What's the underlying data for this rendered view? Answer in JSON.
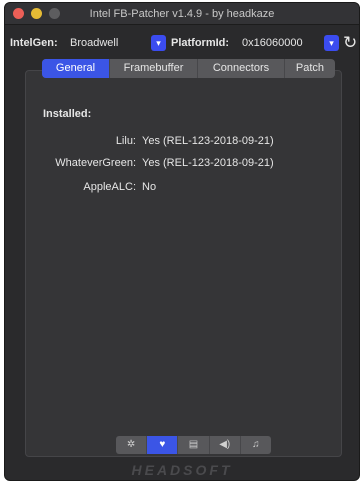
{
  "window": {
    "title": "Intel FB-Patcher v1.4.9 - by headkaze"
  },
  "toolbar": {
    "intelgen_label": "IntelGen:",
    "intelgen_value": "Broadwell",
    "platformid_label": "PlatformId:",
    "platformid_value": "0x16060000",
    "refresh_icon": "refresh-icon"
  },
  "tabs": [
    {
      "label": "General",
      "active": true
    },
    {
      "label": "Framebuffer",
      "active": false
    },
    {
      "label": "Connectors",
      "active": false
    },
    {
      "label": "Patch",
      "active": false
    }
  ],
  "general": {
    "installed_heading": "Installed:",
    "rows": [
      {
        "key": "Lilu:",
        "value": "Yes (REL-123-2018-09-21)"
      },
      {
        "key": "WhateverGreen:",
        "value": "Yes (REL-123-2018-09-21)"
      },
      {
        "key": "AppleALC:",
        "value": "No"
      }
    ]
  },
  "bottom_segments": [
    {
      "icon": "gear-icon",
      "glyph": "✲",
      "active": false
    },
    {
      "icon": "heart-icon",
      "glyph": "♥",
      "active": true
    },
    {
      "icon": "document-icon",
      "glyph": "▤",
      "active": false
    },
    {
      "icon": "speaker-icon",
      "glyph": "◀)",
      "active": false
    },
    {
      "icon": "music-icon",
      "glyph": "♫",
      "active": false
    }
  ],
  "brand": "HEADSOFT",
  "colors": {
    "accent": "#3b55e6",
    "window_bg": "#2a2a2c",
    "panel_bg": "#353537"
  }
}
